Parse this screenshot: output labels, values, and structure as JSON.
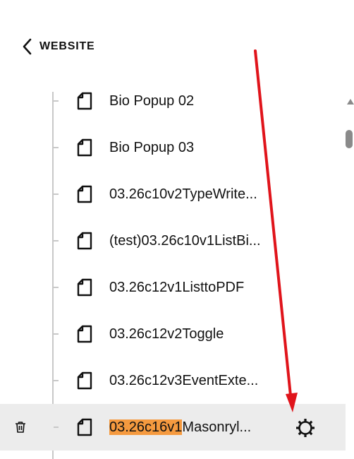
{
  "header": {
    "back_label": "WEBSITE"
  },
  "pages": [
    {
      "title": "Bio Popup 02",
      "icon": "page-icon"
    },
    {
      "title": "Bio Popup 03",
      "icon": "page-icon"
    },
    {
      "title": "03.26c10v2TypeWrite...",
      "icon": "page-icon"
    },
    {
      "title": "(test)03.26c10v1ListBi...",
      "icon": "page-icon"
    },
    {
      "title": "03.26c12v1ListtoPDF",
      "icon": "page-icon"
    },
    {
      "title": "03.26c12v2Toggle",
      "icon": "page-icon"
    },
    {
      "title": "03.26c12v3EventExte...",
      "icon": "page-icon"
    }
  ],
  "selected_page": {
    "highlight": "03.26c16v1",
    "rest": "Masonryl...",
    "icon": "page-icon",
    "actions": [
      "trash-icon",
      "gear-icon"
    ]
  },
  "colors": {
    "highlight": "#f59a3f",
    "annotation_arrow": "#e0141b",
    "selected_row": "#ececec"
  }
}
